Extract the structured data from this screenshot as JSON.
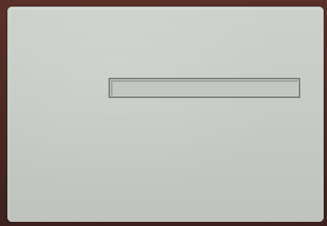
{
  "screen": {
    "text_field": {
      "value": "",
      "placeholder": ""
    }
  }
}
